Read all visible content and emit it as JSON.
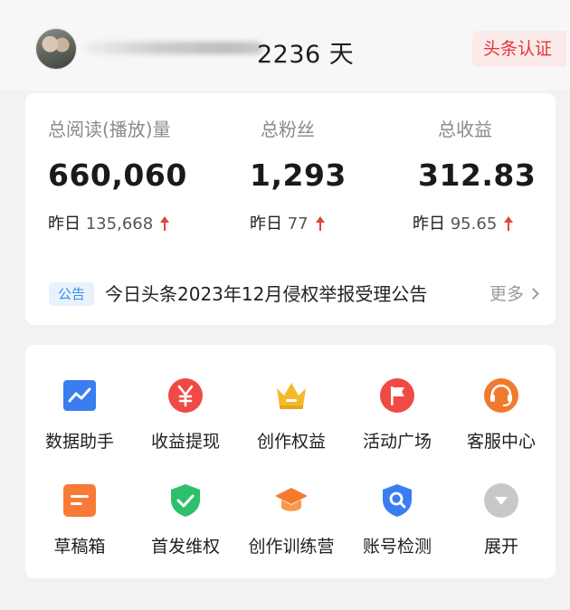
{
  "header": {
    "days_text": "2236 天",
    "certification_badge": "头条认证"
  },
  "stats": [
    {
      "label": "总阅读(播放)量",
      "value": "660,060",
      "yesterday_label": "昨日",
      "yesterday_value": "135,668"
    },
    {
      "label": "总粉丝",
      "value": "1,293",
      "yesterday_label": "昨日",
      "yesterday_value": "77"
    },
    {
      "label": "总收益",
      "value": "312.83",
      "yesterday_label": "昨日",
      "yesterday_value": "95.65"
    }
  ],
  "notice": {
    "tag": "公告",
    "text": "今日头条2023年12月侵权举报受理公告",
    "more_label": "更多"
  },
  "tools": [
    {
      "label": "数据助手",
      "icon": "data-assistant-icon",
      "color": "#3a7df0"
    },
    {
      "label": "收益提现",
      "icon": "yen-withdraw-icon",
      "color": "#f04a46"
    },
    {
      "label": "创作权益",
      "icon": "crown-icon",
      "color": "#f5b92c"
    },
    {
      "label": "活动广场",
      "icon": "flag-icon",
      "color": "#ef4a45"
    },
    {
      "label": "客服中心",
      "icon": "headset-icon",
      "color": "#f07a2e"
    },
    {
      "label": "草稿箱",
      "icon": "draft-box-icon",
      "color": "#f77a36"
    },
    {
      "label": "首发维权",
      "icon": "shield-check-icon",
      "color": "#2fbf6a"
    },
    {
      "label": "创作训练营",
      "icon": "graduation-cap-icon",
      "color": "#f57a2c"
    },
    {
      "label": "账号检测",
      "icon": "account-check-icon",
      "color": "#3a7df0"
    },
    {
      "label": "展开",
      "icon": "expand-icon",
      "color": "#c8c8c8"
    }
  ]
}
